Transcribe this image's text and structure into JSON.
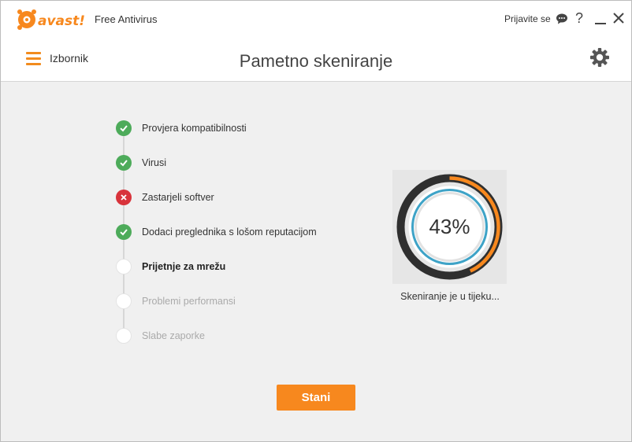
{
  "app": {
    "brand": "avast!",
    "product": "Free Antivirus",
    "sign_in": "Prijavite se",
    "help": "?"
  },
  "header": {
    "menu_label": "Izbornik",
    "title": "Pametno skeniranje"
  },
  "steps": [
    {
      "label": "Provjera kompatibilnosti",
      "status": "done"
    },
    {
      "label": "Virusi",
      "status": "done"
    },
    {
      "label": "Zastarjeli softver",
      "status": "error"
    },
    {
      "label": "Dodaci preglednika s lošom reputacijom",
      "status": "done"
    },
    {
      "label": "Prijetnje za mrežu",
      "status": "active"
    },
    {
      "label": "Problemi performansi",
      "status": "pending"
    },
    {
      "label": "Slabe zaporke",
      "status": "pending"
    }
  ],
  "progress": {
    "percent_text": "43%",
    "fraction": 0.43,
    "status": "Skeniranje je u tijeku..."
  },
  "stop_label": "Stani",
  "colors": {
    "accent": "#f7881e",
    "ok": "#4dab5a",
    "error": "#d8333b",
    "ring_inner": "#3ea3c7"
  },
  "icons": [
    "avast-logo",
    "chat-icon",
    "help-icon",
    "minimize-icon",
    "close-icon",
    "hamburger-icon",
    "gear-icon",
    "check-icon",
    "cross-icon"
  ]
}
